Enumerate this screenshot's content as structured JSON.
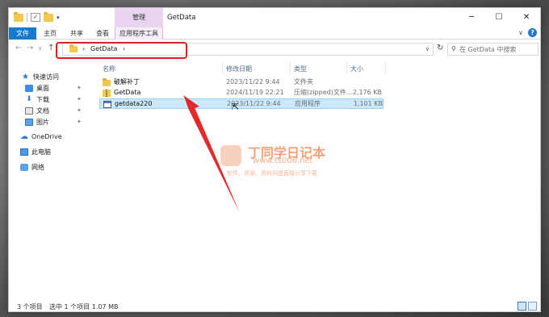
{
  "window": {
    "title": "GetData",
    "context_tab": "管理",
    "controls": {
      "minimize": "─",
      "maximize": "☐",
      "close": "✕"
    }
  },
  "qat": {
    "dropdown": "▾"
  },
  "ribbon": {
    "file": "文件",
    "home": "主页",
    "share": "共享",
    "view": "查看",
    "app_tools": "应用程序工具",
    "collapse": "∨",
    "help": "?"
  },
  "nav": {
    "back": "←",
    "forward": "→",
    "recent": "∨",
    "up": "↑"
  },
  "address": {
    "root_chevron": "›",
    "segment": "GetData",
    "segment_chevron": "›",
    "dropdown": "∨",
    "refresh": "↻"
  },
  "search": {
    "placeholder": "在 GetData 中搜索",
    "icon": "⚲"
  },
  "sidebar": {
    "quick_access": "快速访问",
    "items": [
      {
        "label": "桌面",
        "icon": "desktop-icon",
        "pinned": true
      },
      {
        "label": "下载",
        "icon": "download-icon",
        "pinned": true
      },
      {
        "label": "文档",
        "icon": "document-icon",
        "pinned": true
      },
      {
        "label": "图片",
        "icon": "picture-icon",
        "pinned": true
      }
    ],
    "onedrive": "OneDrive",
    "this_pc": "此电脑",
    "network": "网络",
    "pin_glyph": "📌"
  },
  "columns": {
    "name": "名称",
    "date": "修改日期",
    "type": "类型",
    "size": "大小"
  },
  "files": [
    {
      "name": "破解补丁",
      "date": "2023/11/22 9:44",
      "type": "文件夹",
      "size": "",
      "icon": "folder-icon"
    },
    {
      "name": "GetData",
      "date": "2024/11/19 22:21",
      "type": "压缩(zipped)文件...",
      "size": "2,176 KB",
      "icon": "zip-folder-icon"
    },
    {
      "name": "getdata220",
      "date": "2023/11/22 9:44",
      "type": "应用程序",
      "size": "1,101 KB",
      "icon": "application-icon",
      "selected": true
    }
  ],
  "watermark": {
    "title": "丁同学日记本",
    "url": "www.ts006.net",
    "subtitle": "软件、资源、资料网盘直接分享下载"
  },
  "status": {
    "count": "3 个项目",
    "selection": "选中 1 个项目  1.07 MB"
  },
  "colors": {
    "accent": "#1979ca",
    "context_tab": "#e8d4f0",
    "selection": "#cce8ff",
    "annotation": "#e02020"
  }
}
